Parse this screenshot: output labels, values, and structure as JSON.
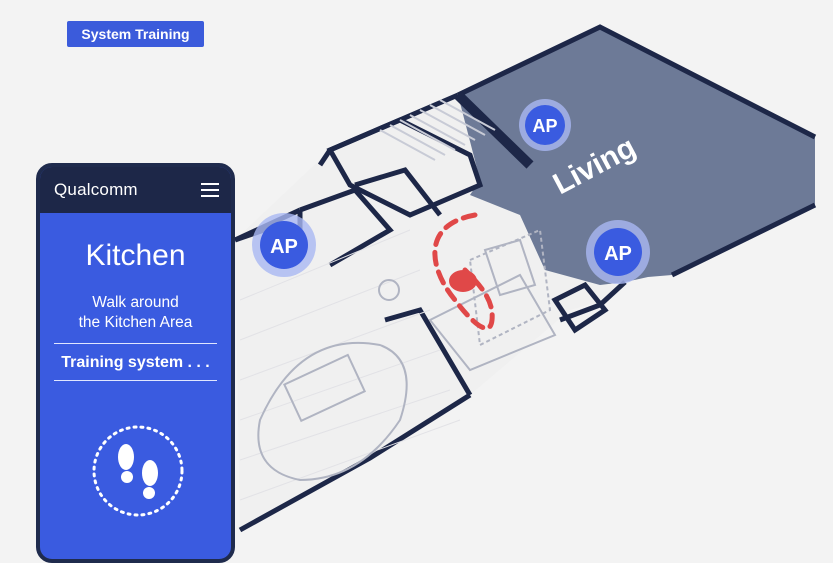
{
  "header": {
    "badge": "System Training"
  },
  "map": {
    "room_label": "Living",
    "access_points": [
      {
        "label": "AP"
      },
      {
        "label": "AP"
      },
      {
        "label": "AP"
      }
    ],
    "colors": {
      "living_fill": "#6d7a97",
      "walls": "#1d2748",
      "ap": "#3a5be0",
      "ap_ring": "#a9b8f2",
      "path": "#e04848"
    }
  },
  "phone": {
    "brand": "Qualcomm",
    "room_title": "Kitchen",
    "instruction_line1": "Walk around",
    "instruction_line2": "the Kitchen Area",
    "status": "Training system . . .",
    "menu_icon": "hamburger-menu-icon",
    "steps_icon": "footsteps-icon"
  }
}
